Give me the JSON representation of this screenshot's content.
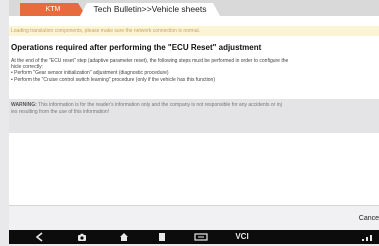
{
  "tabs": {
    "home_label": "KTM",
    "current_label": "Tech Bulletin>>Vehicle sheets"
  },
  "notice": "Loading translation components, please make sure the network connection is normal.",
  "title": "Operations required after performing the \"ECU Reset\" adjustment",
  "body": {
    "intro_line1": "At the end of the \"ECU reset\" step (adaptive parameter reset), the following steps must be performed in order to configure the",
    "intro_line2": "hicle correctly:",
    "step1": "• Perform \"Gear sensor initialization\" adjustment (diagnostic procedure)",
    "step2": "• Perform the \"Cruise control switch learning\" procedure (only if the vehicle has this function)"
  },
  "warning": {
    "label": "WARNING:",
    "line1": " This information is for the reader's information only and the company is not responsible for any accidents or inj",
    "line2": "ies resulting from the use of this information!"
  },
  "bottom": {
    "cancel_label": "Cance"
  },
  "navbar": {
    "icons": [
      "back-icon",
      "camera-icon",
      "home-icon",
      "recents-icon",
      "screenshot-icon",
      "vci-label",
      "signal-icon"
    ],
    "vci_text": "VCI"
  },
  "colors": {
    "tab_accent": "#e66b3d",
    "notice_bg": "#fbf5d6",
    "warning_bg": "#e4e4e6",
    "navbar_bg": "#0c0c0c"
  }
}
